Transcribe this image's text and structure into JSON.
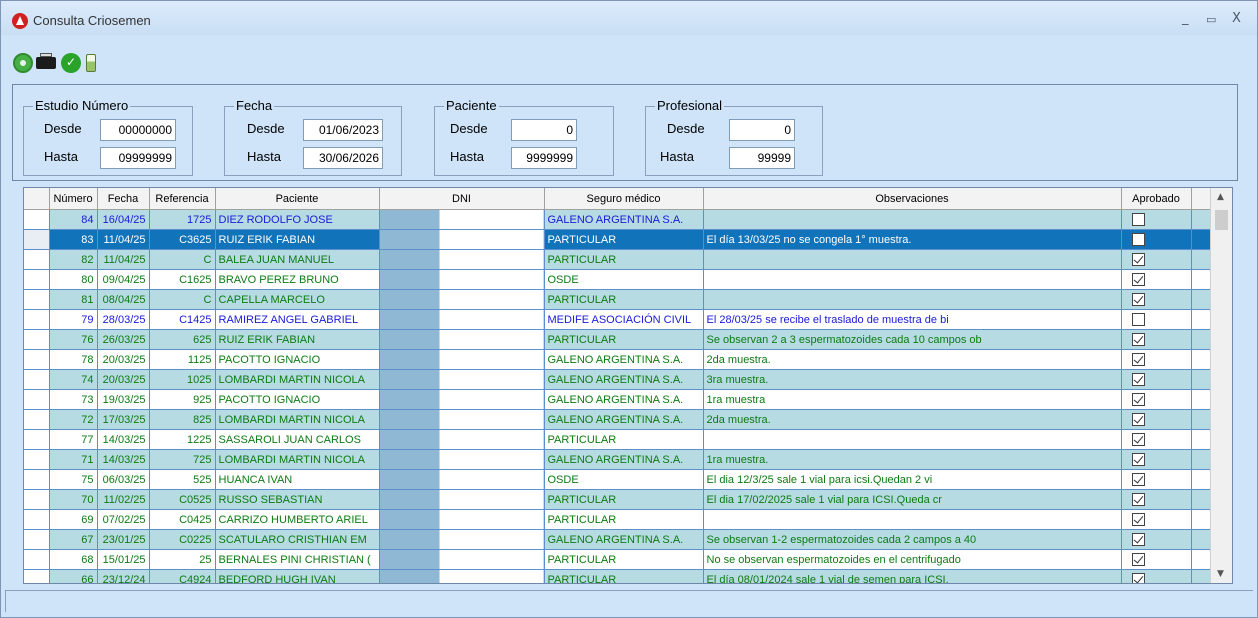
{
  "window": {
    "title": "Consulta Criosemen",
    "minimize": "_",
    "maximize": "▭",
    "close": "X"
  },
  "toolbar": {
    "icons": [
      "refresh-icon",
      "print-icon",
      "check-icon",
      "vial-icon"
    ]
  },
  "filters": {
    "estudio": {
      "legend": "Estudio Número",
      "desde_label": "Desde",
      "hasta_label": "Hasta",
      "desde": "00000000",
      "hasta": "09999999"
    },
    "fecha": {
      "legend": "Fecha",
      "desde_label": "Desde",
      "hasta_label": "Hasta",
      "desde": "01/06/2023",
      "hasta": "30/06/2026"
    },
    "paciente": {
      "legend": "Paciente",
      "desde_label": "Desde",
      "hasta_label": "Hasta",
      "desde": "0",
      "hasta": "9999999"
    },
    "profesional": {
      "legend": "Profesional",
      "desde_label": "Desde",
      "hasta_label": "Hasta",
      "desde": "0",
      "hasta": "99999"
    }
  },
  "grid": {
    "columns": [
      "Número",
      "Fecha",
      "Referencia",
      "Paciente",
      "DNI",
      "Seguro médico",
      "Observaciones",
      "Aprobado"
    ],
    "rows": [
      {
        "numero": "84",
        "fecha": "16/04/25",
        "referencia": "1725",
        "paciente": "DIEZ RODOLFO JOSE",
        "dni": "",
        "seguro": "GALENO ARGENTINA S.A.",
        "obs": "",
        "aprobado": false,
        "style": "blue"
      },
      {
        "numero": "83",
        "fecha": "11/04/25",
        "referencia": "C3625",
        "paciente": "RUIZ ERIK FABIAN",
        "dni": "",
        "seguro": "PARTICULAR",
        "obs": "El día 13/03/25 no se congela 1° muestra.",
        "aprobado": false,
        "style": "sel"
      },
      {
        "numero": "82",
        "fecha": "11/04/25",
        "referencia": "C",
        "paciente": "BALEA JUAN MANUEL",
        "dni": "",
        "seguro": "PARTICULAR",
        "obs": "",
        "aprobado": true,
        "style": "green"
      },
      {
        "numero": "80",
        "fecha": "09/04/25",
        "referencia": "C1625",
        "paciente": "BRAVO PEREZ BRUNO",
        "dni": "",
        "seguro": "OSDE",
        "obs": "",
        "aprobado": true,
        "style": "green"
      },
      {
        "numero": "81",
        "fecha": "08/04/25",
        "referencia": "C",
        "paciente": "CAPELLA MARCELO",
        "dni": "",
        "seguro": "PARTICULAR",
        "obs": "",
        "aprobado": true,
        "style": "green"
      },
      {
        "numero": "79",
        "fecha": "28/03/25",
        "referencia": "C1425",
        "paciente": "RAMIREZ ANGEL GABRIEL",
        "dni": "",
        "seguro": "MEDIFE ASOCIACIÓN CIVIL",
        "obs": "El 28/03/25 se recibe el traslado de muestra de bi",
        "aprobado": false,
        "style": "blue"
      },
      {
        "numero": "76",
        "fecha": "26/03/25",
        "referencia": "625",
        "paciente": "RUIZ ERIK FABIAN",
        "dni": "",
        "seguro": "PARTICULAR",
        "obs": "Se observan 2 a 3 espermatozoides cada 10 campos ob",
        "aprobado": true,
        "style": "green"
      },
      {
        "numero": "78",
        "fecha": "20/03/25",
        "referencia": "1125",
        "paciente": "PACOTTO IGNACIO",
        "dni": "",
        "seguro": "GALENO ARGENTINA S.A.",
        "obs": "2da muestra.",
        "aprobado": true,
        "style": "green"
      },
      {
        "numero": "74",
        "fecha": "20/03/25",
        "referencia": "1025",
        "paciente": "LOMBARDI MARTIN NICOLA",
        "dni": "",
        "seguro": "GALENO ARGENTINA S.A.",
        "obs": "3ra muestra.",
        "aprobado": true,
        "style": "green"
      },
      {
        "numero": "73",
        "fecha": "19/03/25",
        "referencia": "925",
        "paciente": "PACOTTO IGNACIO",
        "dni": "",
        "seguro": "GALENO ARGENTINA S.A.",
        "obs": "1ra muestra",
        "aprobado": true,
        "style": "green"
      },
      {
        "numero": "72",
        "fecha": "17/03/25",
        "referencia": "825",
        "paciente": "LOMBARDI MARTIN NICOLA",
        "dni": "",
        "seguro": "GALENO ARGENTINA S.A.",
        "obs": "2da muestra.",
        "aprobado": true,
        "style": "green"
      },
      {
        "numero": "77",
        "fecha": "14/03/25",
        "referencia": "1225",
        "paciente": "SASSAROLI JUAN CARLOS",
        "dni": "",
        "seguro": "PARTICULAR",
        "obs": "",
        "aprobado": true,
        "style": "green"
      },
      {
        "numero": "71",
        "fecha": "14/03/25",
        "referencia": "725",
        "paciente": "LOMBARDI MARTIN NICOLA",
        "dni": "",
        "seguro": "GALENO ARGENTINA S.A.",
        "obs": "1ra muestra.",
        "aprobado": true,
        "style": "green"
      },
      {
        "numero": "75",
        "fecha": "06/03/25",
        "referencia": "525",
        "paciente": "HUANCA IVAN",
        "dni": "",
        "seguro": "OSDE",
        "obs": "El dia 12/3/25 sale 1 vial para icsi.Quedan 2 vi",
        "aprobado": true,
        "style": "green"
      },
      {
        "numero": "70",
        "fecha": "11/02/25",
        "referencia": "C0525",
        "paciente": "RUSSO SEBASTIAN",
        "dni": "",
        "seguro": "PARTICULAR",
        "obs": "El dia 17/02/2025 sale 1 vial para ICSI.Queda cr",
        "aprobado": true,
        "style": "green"
      },
      {
        "numero": "69",
        "fecha": "07/02/25",
        "referencia": "C0425",
        "paciente": "CARRIZO HUMBERTO ARIEL",
        "dni": "",
        "seguro": "PARTICULAR",
        "obs": "",
        "aprobado": true,
        "style": "green"
      },
      {
        "numero": "67",
        "fecha": "23/01/25",
        "referencia": "C0225",
        "paciente": "SCATULARO CRISTHIAN EM",
        "dni": "",
        "seguro": "GALENO ARGENTINA S.A.",
        "obs": "Se observan 1-2 espermatozoides cada 2 campos a 40",
        "aprobado": true,
        "style": "green"
      },
      {
        "numero": "68",
        "fecha": "15/01/25",
        "referencia": "25",
        "paciente": "BERNALES PINI CHRISTIAN (",
        "dni": "",
        "seguro": "PARTICULAR",
        "obs": "No se observan espermatozoides en el centrifugado",
        "aprobado": true,
        "style": "green"
      },
      {
        "numero": "66",
        "fecha": "23/12/24",
        "referencia": "C4924",
        "paciente": "BEDFORD HUGH IVAN",
        "dni": "",
        "seguro": "PARTICULAR",
        "obs": "El día 08/01/2024 sale 1 vial de semen para ICSI.",
        "aprobado": true,
        "style": "green"
      }
    ]
  },
  "scrollbar": {
    "up": "▲",
    "down": "▼"
  }
}
